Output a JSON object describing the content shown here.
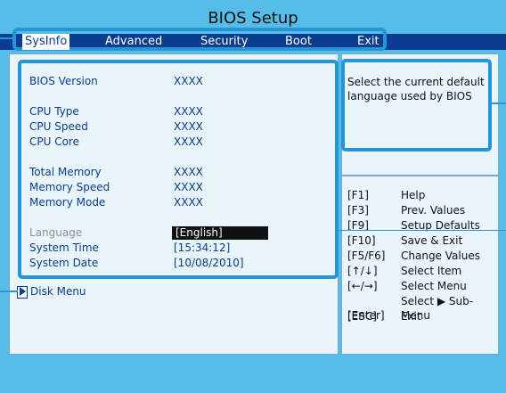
{
  "window": {
    "title": "BIOS Setup"
  },
  "menu": {
    "items": [
      "SysInfo",
      "Advanced",
      "Security",
      "Boot",
      "Exit"
    ],
    "active": "SysInfo"
  },
  "sysinfo": {
    "bios_version_label": "BIOS Version",
    "bios_version_value": "XXXX",
    "cpu_type_label": "CPU Type",
    "cpu_type_value": "XXXX",
    "cpu_speed_label": "CPU Speed",
    "cpu_speed_value": "XXXX",
    "cpu_core_label": "CPU Core",
    "cpu_core_value": "XXXX",
    "total_memory_label": "Total Memory",
    "total_memory_value": "XXXX",
    "memory_speed_label": "Memory Speed",
    "memory_speed_value": "XXXX",
    "memory_mode_label": "Memory Mode",
    "memory_mode_value": "XXXX",
    "language_label": "Language",
    "language_value": "[English]",
    "system_time_label": "System Time",
    "system_time_value": "[15:34:12]",
    "system_date_label": "System Date",
    "system_date_value": "[10/08/2010]",
    "disk_menu_label": "Disk Menu"
  },
  "help": {
    "text": "Select the current default language used by BIOS"
  },
  "keys": [
    {
      "key": "[F1]",
      "desc": "Help"
    },
    {
      "key": "[F3]",
      "desc": "Prev. Values"
    },
    {
      "key": "[F9]",
      "desc": "Setup Defaults"
    },
    {
      "key": "[F10]",
      "desc": "Save & Exit"
    },
    {
      "key": "[F5/F6]",
      "desc": "Change Values"
    },
    {
      "key": "[↑/↓]",
      "desc": "Select Item"
    },
    {
      "key": "[←/→]",
      "desc": "Select Menu"
    },
    {
      "key": "[Enter]",
      "desc": "Select ▶ Sub-Menu"
    },
    {
      "key": "[ESC]",
      "desc": "Exit"
    }
  ],
  "colors": {
    "background": "#55bde8",
    "menubar": "#0a3d8f",
    "panel": "#eaf4fb",
    "highlight": "#2496d8",
    "text_blue": "#0a3d8f",
    "text_gray": "#8f8f8f",
    "selection": "#111111"
  },
  "icons": {
    "disk_menu_marker": "triangle-right-icon"
  }
}
